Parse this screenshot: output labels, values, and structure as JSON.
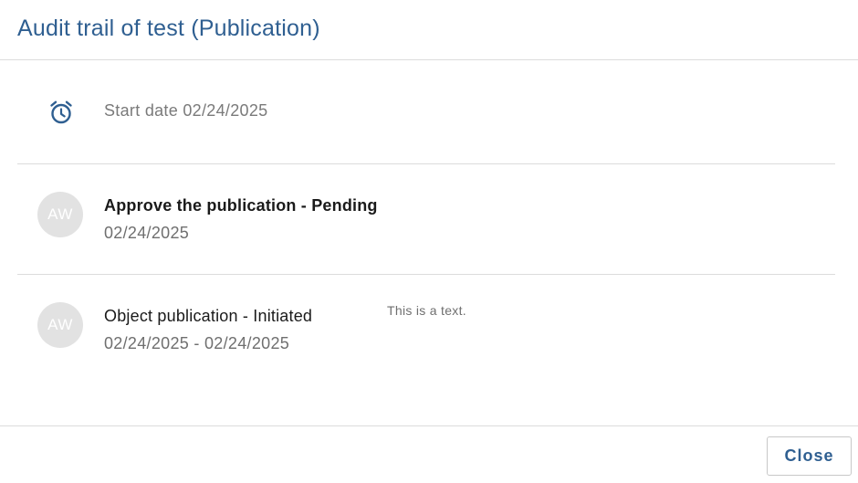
{
  "dialog": {
    "title": "Audit trail of test (Publication)"
  },
  "trail": {
    "start": {
      "icon": "alarm-clock-icon",
      "text": "Start date 02/24/2025"
    },
    "steps": [
      {
        "avatar": "AW",
        "title": "Approve the publication - Pending",
        "date": "02/24/2025",
        "comment": ""
      },
      {
        "avatar": "AW",
        "title": "Object publication - Initiated",
        "date": "02/24/2025 - 02/24/2025",
        "comment": "This is a text."
      }
    ]
  },
  "footer": {
    "close_label": "Close"
  },
  "colors": {
    "accent": "#2f5f91",
    "divider": "#dcdcdc",
    "avatar_bg": "#e2e2e2"
  }
}
